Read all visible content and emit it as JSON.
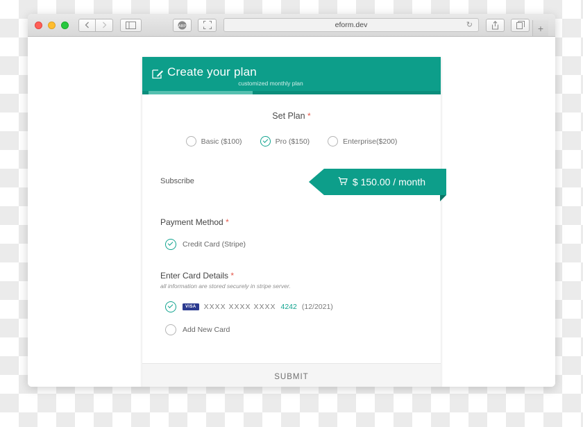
{
  "browser": {
    "url": "eform.dev",
    "back_icon": "chevron-left-icon",
    "forward_icon": "chevron-right-icon",
    "sidebar_icon": "sidebar-icon",
    "adblock_icon": "ABP",
    "fullscreen_icon": "expand-icon",
    "reload_icon": "↻",
    "share_icon": "⇧",
    "tabs_icon": "copy-icon",
    "new_tab_icon": "+"
  },
  "form": {
    "header": {
      "title": "Create your plan",
      "subtitle": "customized monthly plan",
      "icon": "edit-pencil-icon"
    },
    "set_plan": {
      "label": "Set Plan",
      "required_mark": "*",
      "options": [
        {
          "label": "Basic ($100)",
          "selected": false
        },
        {
          "label": "Pro ($150)",
          "selected": true
        },
        {
          "label": "Enterprise($200)",
          "selected": false
        }
      ]
    },
    "subscribe": {
      "label": "Subscribe",
      "cart_icon": "🛒",
      "price": "$ 150.00 / month"
    },
    "payment_method": {
      "label": "Payment Method",
      "required_mark": "*",
      "options": [
        {
          "label": "Credit Card (Stripe)",
          "selected": true
        }
      ]
    },
    "card_details": {
      "label": "Enter Card Details",
      "required_mark": "*",
      "note": "all information are stored securely in stripe server.",
      "saved_card": {
        "selected": true,
        "brand": "VISA",
        "mask": "XXXX  XXXX  XXXX",
        "last4": "4242",
        "expiry": "(12/2021)"
      },
      "add_new_card": {
        "label": "Add New Card",
        "selected": false
      }
    },
    "submit_label": "SUBMIT"
  },
  "colors": {
    "teal": "#0d9e8a",
    "teal_light": "#56c0b0",
    "teal_dark": "#0a7566",
    "accent_check": "#0fa38e",
    "required": "#e5574a",
    "visa_blue": "#2b3a8f"
  }
}
